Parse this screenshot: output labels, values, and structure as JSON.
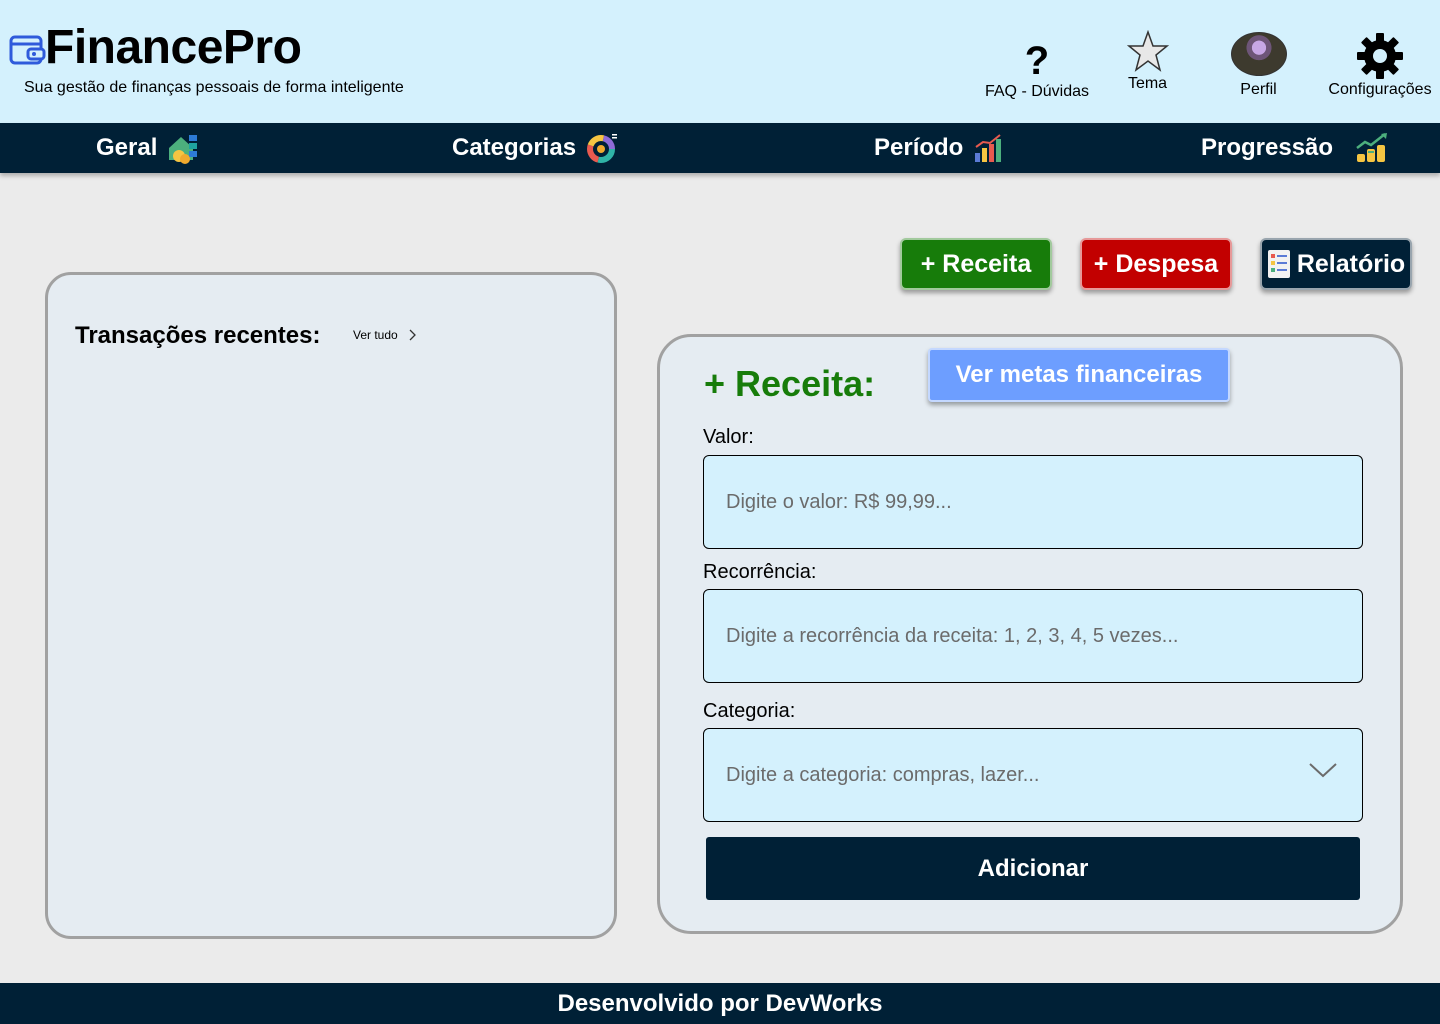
{
  "header": {
    "app_name": "FinancePro",
    "tagline": "Sua gestão de finanças pessoais de forma inteligente",
    "actions": {
      "faq": {
        "icon": "question-mark-icon",
        "label": "FAQ - Dúvidas"
      },
      "tema": {
        "icon": "star-icon",
        "label": "Tema"
      },
      "perfil": {
        "icon": "avatar",
        "label": "Perfil"
      },
      "config": {
        "icon": "gear-icon",
        "label": "Configurações"
      }
    }
  },
  "nav": {
    "items": [
      {
        "label": "Geral",
        "icon": "house-coins-icon"
      },
      {
        "label": "Categorias",
        "icon": "donut-chart-icon"
      },
      {
        "label": "Período",
        "icon": "bar-chart-icon"
      },
      {
        "label": "Progressão",
        "icon": "growth-coins-icon"
      }
    ]
  },
  "actions": {
    "receita": "+ Receita",
    "despesa": "+ Despesa",
    "relatorio": "Relatório"
  },
  "recent": {
    "title": "Transações recentes:",
    "ver_tudo": "Ver tudo"
  },
  "form": {
    "title": "+ Receita:",
    "metas_button": "Ver metas financeiras",
    "valor": {
      "label": "Valor:",
      "placeholder": "Digite o valor: R$ 99,99..."
    },
    "recorrencia": {
      "label": "Recorrência:",
      "placeholder": "Digite a recorrência da receita: 1, 2, 3, 4, 5 vezes..."
    },
    "categoria": {
      "label": "Categoria:",
      "placeholder": "Digite a categoria: compras, lazer..."
    },
    "submit": "Adicionar"
  },
  "footer": {
    "text": "Desenvolvido por DevWorks"
  },
  "colors": {
    "header_bg": "#d4f1fd",
    "nav_bg": "#002036",
    "receita_green": "#177c0a",
    "despesa_red": "#c20000",
    "metas_blue": "#6d9eff",
    "panel_bg": "#e5ecf2"
  }
}
